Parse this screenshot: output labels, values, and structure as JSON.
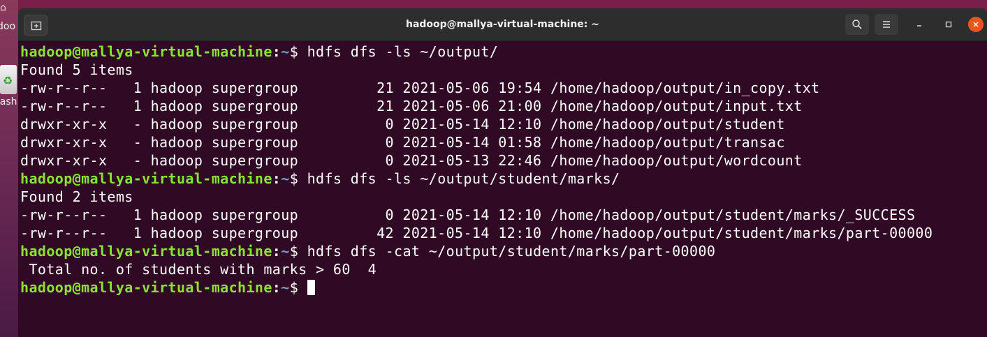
{
  "desktop": {
    "home_label": "doo",
    "trash_label": "rash"
  },
  "window": {
    "title": "hadoop@mallya-virtual-machine: ~"
  },
  "terminal": {
    "prompt": {
      "user_host": "hadoop@mallya-virtual-machine",
      "colon": ":",
      "path": "~",
      "dollar": "$"
    },
    "lines": [
      {
        "type": "prompt",
        "command": " hdfs dfs -ls ~/output/"
      },
      {
        "type": "output",
        "text": "Found 5 items"
      },
      {
        "type": "output",
        "text": "-rw-r--r--   1 hadoop supergroup         21 2021-05-06 19:54 /home/hadoop/output/in_copy.txt"
      },
      {
        "type": "output",
        "text": "-rw-r--r--   1 hadoop supergroup         21 2021-05-06 21:00 /home/hadoop/output/input.txt"
      },
      {
        "type": "output",
        "text": "drwxr-xr-x   - hadoop supergroup          0 2021-05-14 12:10 /home/hadoop/output/student"
      },
      {
        "type": "output",
        "text": "drwxr-xr-x   - hadoop supergroup          0 2021-05-14 01:58 /home/hadoop/output/transac"
      },
      {
        "type": "output",
        "text": "drwxr-xr-x   - hadoop supergroup          0 2021-05-13 22:46 /home/hadoop/output/wordcount"
      },
      {
        "type": "prompt",
        "command": " hdfs dfs -ls ~/output/student/marks/"
      },
      {
        "type": "output",
        "text": "Found 2 items"
      },
      {
        "type": "output",
        "text": "-rw-r--r--   1 hadoop supergroup          0 2021-05-14 12:10 /home/hadoop/output/student/marks/_SUCCESS"
      },
      {
        "type": "output",
        "text": "-rw-r--r--   1 hadoop supergroup         42 2021-05-14 12:10 /home/hadoop/output/student/marks/part-00000"
      },
      {
        "type": "prompt",
        "command": " hdfs dfs -cat ~/output/student/marks/part-00000"
      },
      {
        "type": "output",
        "text": " Total no. of students with marks > 60  4"
      },
      {
        "type": "prompt",
        "command": " ",
        "cursor": true
      }
    ]
  },
  "icons": {
    "new_tab": "new-tab-icon",
    "search": "search-icon",
    "menu": "hamburger-menu-icon",
    "minimize": "minimize-icon",
    "maximize": "maximize-icon",
    "close": "close-icon"
  },
  "colors": {
    "terminal_bg": "#300a24",
    "prompt_user": "#8ae234",
    "prompt_path": "#729fcf",
    "close_button": "#e95420"
  }
}
